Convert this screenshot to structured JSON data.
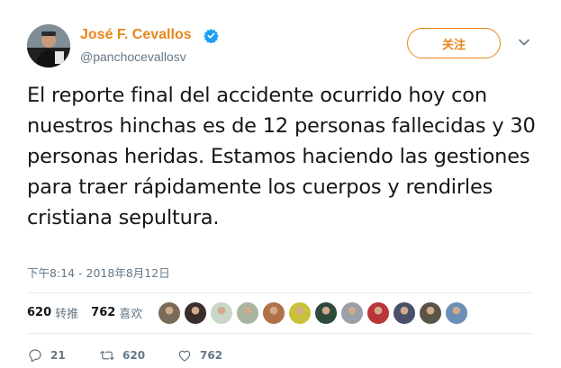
{
  "author": {
    "display_name": "José F. Cevallos",
    "username": "@panchocevallosv",
    "verified": true,
    "accent_color": "#e8851a"
  },
  "follow_button": {
    "label": "关注"
  },
  "tweet": {
    "text": "El reporte final del accidente ocurrido hoy con nuestros hinchas es de 12 personas fallecidas y 30 personas heridas. Estamos haciendo las gestiones para traer rápidamente los cuerpos y rendirles cristiana sepultura.",
    "timestamp": "下午8:14 - 2018年8月12日"
  },
  "stats": {
    "retweets_count": "620",
    "retweets_label": "转推",
    "likes_count": "762",
    "likes_label": "喜欢"
  },
  "likers": [
    {
      "color": "#7a6a5a",
      "icon": "avatar"
    },
    {
      "color": "#3a2e2a",
      "icon": "avatar"
    },
    {
      "color": "#c9d7c8",
      "icon": "avatar"
    },
    {
      "color": "#a8b6a0",
      "icon": "avatar"
    },
    {
      "color": "#b0704a",
      "icon": "avatar"
    },
    {
      "color": "#c8c23a",
      "icon": "avatar"
    },
    {
      "color": "#2f4a3a",
      "icon": "avatar"
    },
    {
      "color": "#9aa0a8",
      "icon": "avatar"
    },
    {
      "color": "#b8353a",
      "icon": "avatar"
    },
    {
      "color": "#4a4f6a",
      "icon": "avatar"
    },
    {
      "color": "#5c5448",
      "icon": "avatar"
    },
    {
      "color": "#6a8fb8",
      "icon": "avatar"
    }
  ],
  "actions": {
    "reply_count": "21",
    "retweet_count": "620",
    "like_count": "762",
    "icons": [
      "reply-icon",
      "retweet-icon",
      "like-icon"
    ]
  }
}
